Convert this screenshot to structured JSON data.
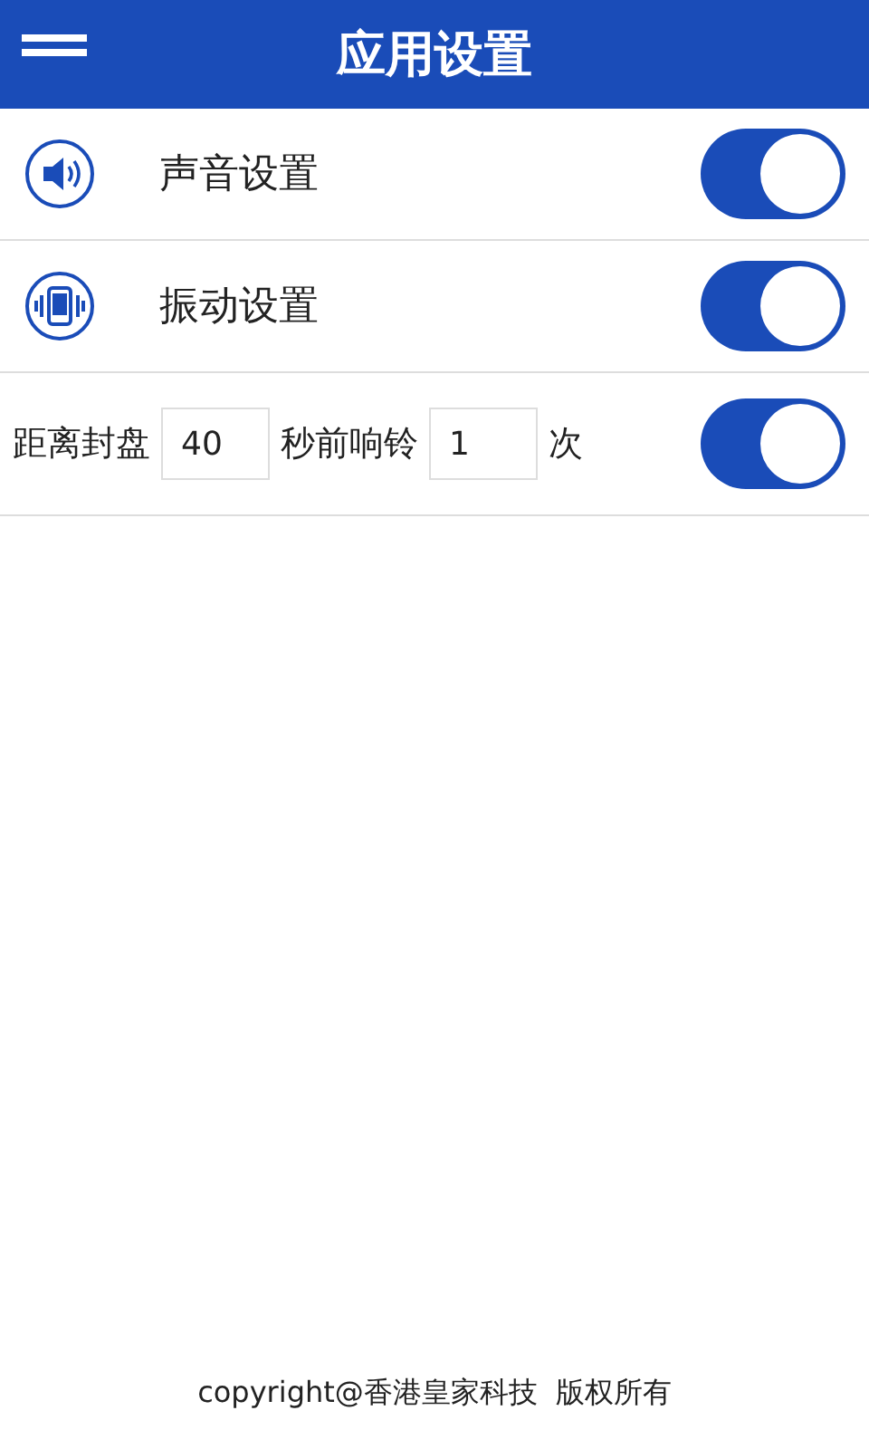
{
  "header": {
    "title": "应用设置"
  },
  "settings": [
    {
      "kind": "sound",
      "label": "声音设置",
      "on": true
    },
    {
      "kind": "vibrate",
      "label": "振动设置",
      "on": true
    }
  ],
  "reminder": {
    "label_before": "距离封盘",
    "seconds": "40",
    "label_middle": "秒前响铃",
    "times": "1",
    "label_after": "次",
    "on": true
  },
  "footer": {
    "copyright": "copyright@香港皇家科技",
    "rights": "版权所有"
  }
}
